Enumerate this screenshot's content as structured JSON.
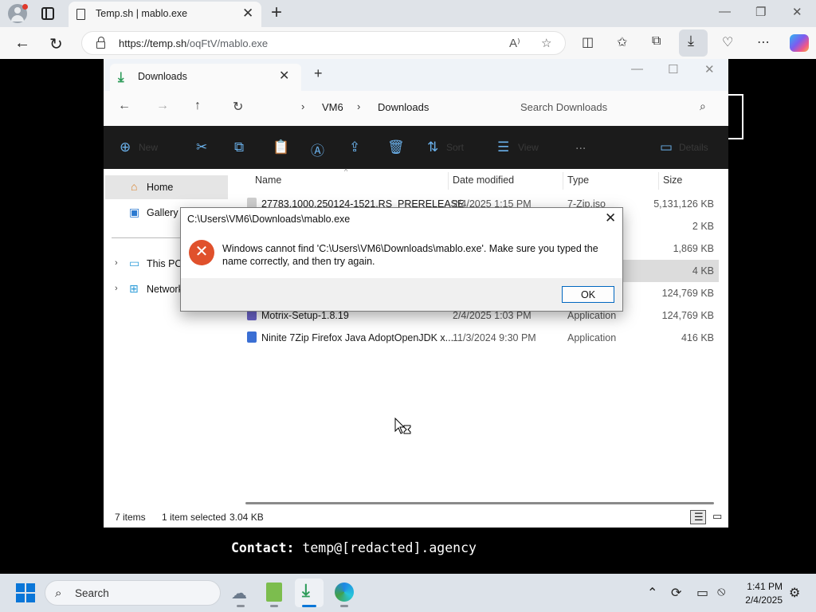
{
  "browser": {
    "tab_title": "Temp.sh | mablo.exe",
    "url_host": "https://temp.sh",
    "url_path": "/oqFtV/mablo.exe"
  },
  "explorer": {
    "tab_title": "Downloads",
    "breadcrumb": [
      "VM6",
      "Downloads"
    ],
    "search_placeholder": "Search Downloads",
    "commands": {
      "new": "New",
      "sort": "Sort",
      "view": "View",
      "details": "Details",
      "more": "..."
    },
    "nav_pane": {
      "home": "Home",
      "gallery": "Gallery",
      "this_pc": "This PC",
      "network": "Network"
    },
    "columns": {
      "name": "Name",
      "date": "Date modified",
      "type": "Type",
      "size": "Size"
    },
    "files": [
      {
        "name": "27783.1000.250124-1521.RS_PRERELEASE_...",
        "date": "2/4/2025 1:15 PM",
        "type": "7-Zip.iso",
        "size": "5,131,126 KB",
        "icon": "iso-icon",
        "color": "#cfcfcf"
      },
      {
        "name": "",
        "date": "",
        "type": "",
        "size": "2 KB",
        "icon": "file-icon",
        "color": "#cfcfcf"
      },
      {
        "name": "",
        "date": "",
        "type": "",
        "size": "1,869 KB",
        "icon": "file-icon",
        "color": "#cfcfcf"
      },
      {
        "name": "",
        "date": "",
        "type": "",
        "size": "4 KB",
        "icon": "file-icon",
        "color": "#cfcfcf"
      },
      {
        "name": "",
        "date": "",
        "type": "",
        "size": "124,769 KB",
        "icon": "file-icon",
        "color": "#cfcfcf"
      },
      {
        "name": "Motrix-Setup-1.8.19",
        "date": "2/4/2025 1:03 PM",
        "type": "Application",
        "size": "124,769 KB",
        "icon": "app-icon",
        "color": "#6a63c8"
      },
      {
        "name": "Ninite 7Zip Firefox Java AdoptOpenJDK x...",
        "date": "11/3/2024 9:30 PM",
        "type": "Application",
        "size": "416 KB",
        "icon": "ninite-icon",
        "color": "#3b6fd4"
      }
    ],
    "status": {
      "items": "7 items",
      "selected": "1 item selected",
      "selected_size": "3.04 KB"
    }
  },
  "dialog": {
    "title": "C:\\Users\\VM6\\Downloads\\mablo.exe",
    "message": "Windows cannot find 'C:\\Users\\VM6\\Downloads\\mablo.exe'. Make sure you typed the name correctly, and then try again.",
    "ok_label": "OK"
  },
  "contact": {
    "label": "Contact:",
    "value": "temp@[redacted].agency"
  },
  "taskbar": {
    "search_label": "Search",
    "time": "1:41 PM",
    "date": "2/4/2025"
  },
  "colors": {
    "accent": "#0067c0",
    "error": "#e0512c",
    "download_green": "#2e9c5a"
  }
}
